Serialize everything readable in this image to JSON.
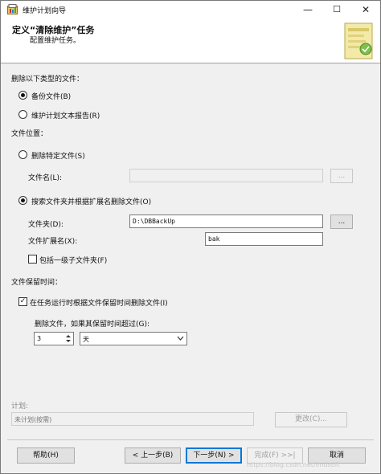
{
  "window": {
    "title": "维护计划向导",
    "minimize": "—",
    "maximize": "☐",
    "close": "✕"
  },
  "header": {
    "title": "定义“清除维护”任务",
    "subtitle": "配置维护任务。"
  },
  "delete_type": {
    "label": "删除以下类型的文件：",
    "backup": "备份文件(B)",
    "report": "维护计划文本报告(R)",
    "selected": "backup"
  },
  "file_location": {
    "label": "文件位置：",
    "specific_file": "删除特定文件(S)",
    "file_name_label": "文件名(L):",
    "file_name_value": "",
    "browse1": "...",
    "search_folder": "搜索文件夹并根据扩展名删除文件(O)",
    "folder_label": "文件夹(D):",
    "folder_value": "D:\\DBBackUp",
    "browse2": "...",
    "extension_label": "文件扩展名(X):",
    "extension_value": "bak",
    "subfolders": "包括一级子文件夹(F)",
    "selected": "search_folder"
  },
  "retention": {
    "label": "文件保留时间：",
    "check_label": "在任务运行时根据文件保留时间删除文件(I)",
    "checked": true,
    "older_than_label": "删除文件，如果其保留时间超过(G):",
    "amount": "3",
    "unit": "天"
  },
  "schedule": {
    "label": "计划:",
    "value": "未计划(按需)",
    "change": "更改(C)..."
  },
  "buttons": {
    "help": "帮助(H)",
    "back": "< 上一步(B)",
    "next": "下一步(N) >",
    "finish": "完成(F) >>|",
    "cancel": "取消"
  },
  "watermark": "https://blog.csdn.net/lmdsoft"
}
